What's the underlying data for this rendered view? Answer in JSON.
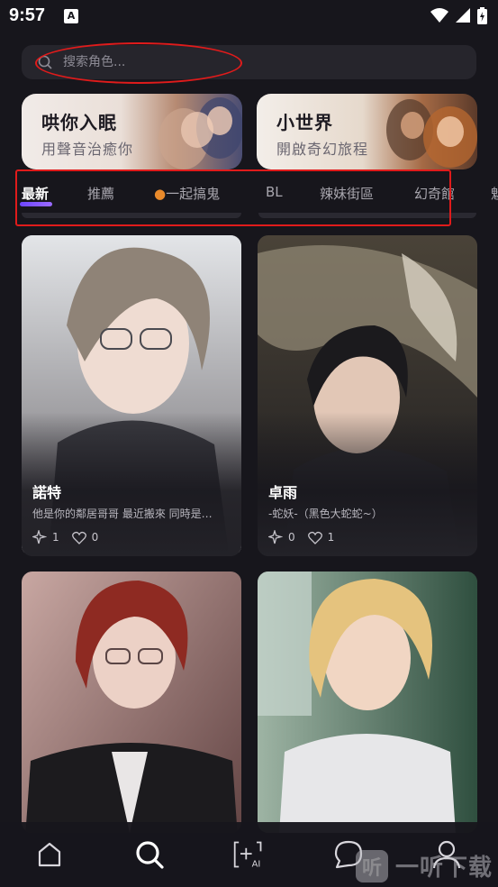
{
  "status_bar": {
    "time": "9:57",
    "notification_badge": "A"
  },
  "search": {
    "placeholder": "搜索角色..."
  },
  "banners": [
    {
      "title": "哄你入眠",
      "subtitle": "用聲音治癒你"
    },
    {
      "title": "小世界",
      "subtitle": "開啟奇幻旅程"
    }
  ],
  "tabs": [
    {
      "label": "最新",
      "active": true
    },
    {
      "label": "推薦"
    },
    {
      "label": "一起搞鬼",
      "icon": "pumpkin-icon"
    },
    {
      "label": "BL"
    },
    {
      "label": "辣妹街區"
    },
    {
      "label": "幻奇館"
    },
    {
      "label": "魅"
    }
  ],
  "cards": [
    {
      "name": "諾特",
      "description": "他是你的鄰居哥哥 最近搬來 同時是…",
      "sparks": "1",
      "likes": "0"
    },
    {
      "name": "卓雨",
      "description": "-蛇妖-（黑色大蛇蛇~）",
      "sparks": "0",
      "likes": "1"
    },
    {
      "name": "",
      "description": "",
      "sparks": "",
      "likes": ""
    },
    {
      "name": "",
      "description": "",
      "sparks": "",
      "likes": ""
    }
  ],
  "nav": [
    {
      "name": "home-icon"
    },
    {
      "name": "search-icon",
      "active": true
    },
    {
      "name": "create-ai-icon",
      "label": "AI"
    },
    {
      "name": "chat-icon"
    },
    {
      "name": "profile-icon"
    }
  ],
  "watermark": {
    "text": "一听下载",
    "logo": "听"
  },
  "colors": {
    "background": "#17161c",
    "accent": "#7b52ff",
    "highlight_red": "#e01b1b"
  }
}
